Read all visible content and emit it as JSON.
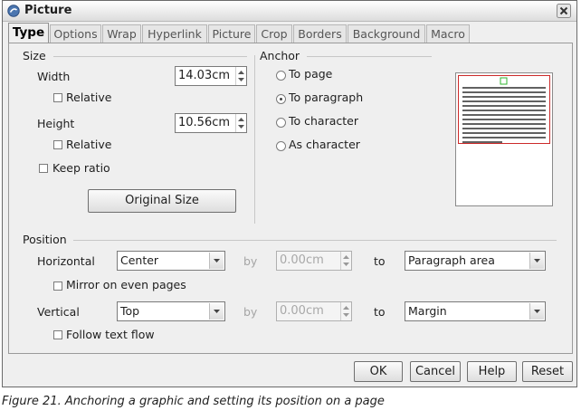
{
  "window": {
    "title": "Picture"
  },
  "tabs": [
    {
      "label": "Type",
      "active": true
    },
    {
      "label": "Options"
    },
    {
      "label": "Wrap"
    },
    {
      "label": "Hyperlink"
    },
    {
      "label": "Picture"
    },
    {
      "label": "Crop"
    },
    {
      "label": "Borders"
    },
    {
      "label": "Background"
    },
    {
      "label": "Macro"
    }
  ],
  "size": {
    "heading": "Size",
    "width_label": "Width",
    "width_value": "14.03cm",
    "relative_width_label": "Relative",
    "height_label": "Height",
    "height_value": "10.56cm",
    "relative_height_label": "Relative",
    "keep_ratio_label": "Keep ratio",
    "original_size_label": "Original Size"
  },
  "anchor": {
    "heading": "Anchor",
    "options": [
      "To page",
      "To paragraph",
      "To character",
      "As character"
    ],
    "selected": "To paragraph"
  },
  "position": {
    "heading": "Position",
    "horizontal_label": "Horizontal",
    "horizontal_value": "Center",
    "by_label": "by",
    "horizontal_by_value": "0.00cm",
    "to_label": "to",
    "horizontal_to_value": "Paragraph area",
    "mirror_label": "Mirror on even pages",
    "vertical_label": "Vertical",
    "vertical_value": "Top",
    "vertical_by_value": "0.00cm",
    "vertical_to_value": "Margin",
    "follow_label": "Follow text flow"
  },
  "buttons": {
    "ok": "OK",
    "cancel": "Cancel",
    "help": "Help",
    "reset": "Reset"
  },
  "caption": "Figure 21. Anchoring a graphic and setting its position on a page",
  "colors": {
    "preview_frame": "#cc2a2a",
    "anchor_marker": "#2fb42f"
  }
}
